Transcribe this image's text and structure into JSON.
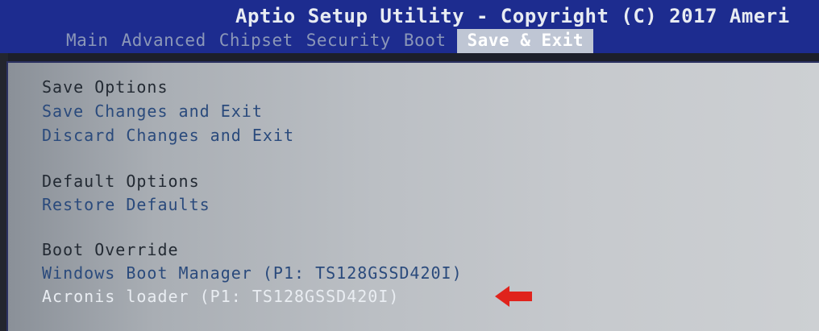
{
  "header": {
    "title": "Aptio Setup Utility - Copyright (C) 2017 Ameri"
  },
  "tabs": [
    {
      "label": "Main"
    },
    {
      "label": "Advanced"
    },
    {
      "label": "Chipset"
    },
    {
      "label": "Security"
    },
    {
      "label": "Boot"
    },
    {
      "label": "Save & Exit"
    }
  ],
  "active_tab": "Save & Exit",
  "save_options": {
    "heading": "Save Options",
    "items": [
      {
        "label": "Save Changes and Exit"
      },
      {
        "label": "Discard Changes and Exit"
      }
    ]
  },
  "default_options": {
    "heading": "Default Options",
    "items": [
      {
        "label": "Restore Defaults"
      }
    ]
  },
  "boot_override": {
    "heading": "Boot Override",
    "items": [
      {
        "label": "Windows Boot Manager (P1: TS128GSSD420I)"
      },
      {
        "label": "Acronis loader (P1: TS128GSSD420I)"
      }
    ]
  },
  "selected_item": "Acronis loader (P1: TS128GSSD420I)",
  "colors": {
    "header_bg": "#1d2c8f",
    "panel_bg": "#bbbfc4",
    "option_text": "#2a4a7c",
    "selected_text": "#e9edf2",
    "arrow": "#e0231c"
  },
  "icons": {
    "pointer": "arrow-left-icon"
  }
}
